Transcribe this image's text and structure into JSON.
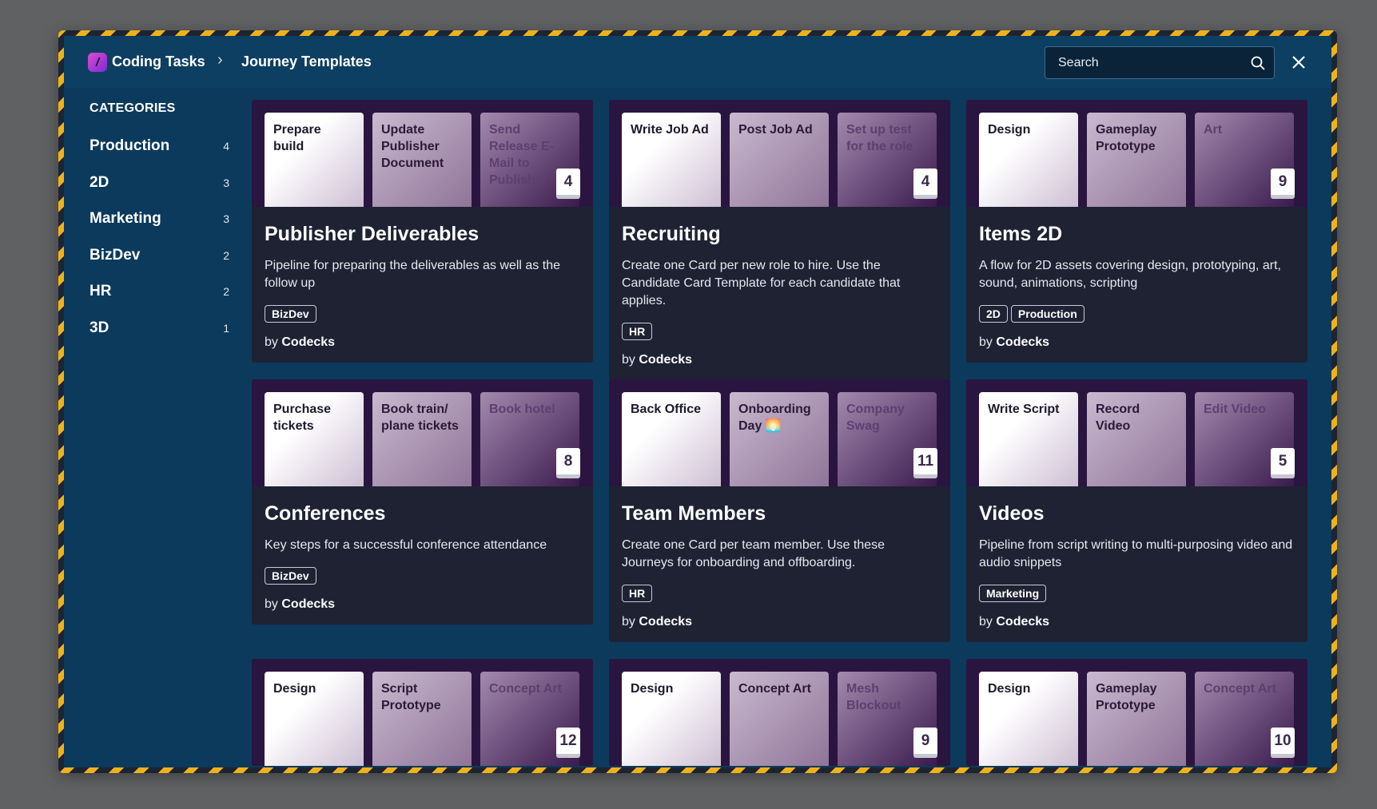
{
  "header": {
    "workspace": "Coding Tasks",
    "separator": "›",
    "current": "Journey Templates",
    "search_placeholder": "Search"
  },
  "sidebar": {
    "title": "CATEGORIES",
    "items": [
      {
        "label": "Production",
        "count": "4"
      },
      {
        "label": "2D",
        "count": "3"
      },
      {
        "label": "Marketing",
        "count": "3"
      },
      {
        "label": "BizDev",
        "count": "2"
      },
      {
        "label": "HR",
        "count": "2"
      },
      {
        "label": "3D",
        "count": "1"
      }
    ]
  },
  "cards": [
    {
      "minis": [
        "Prepare build",
        "Update Publisher Document",
        "Send Release E-Mail to Publisher"
      ],
      "count": "4",
      "title": "Publisher Deliverables",
      "desc": "Pipeline for preparing the deliverables as well as the follow up",
      "tags": [
        "BizDev"
      ],
      "by": "by",
      "author": "Codecks"
    },
    {
      "minis": [
        "Write Job Ad",
        "Post Job Ad",
        "Set up test for the role"
      ],
      "count": "4",
      "title": "Recruiting",
      "desc": "Create one Card per new role to hire. Use the Candidate Card Template for each candidate that applies.",
      "tags": [
        "HR"
      ],
      "by": "by",
      "author": "Codecks"
    },
    {
      "minis": [
        "Design",
        "Gameplay Prototype",
        "Art"
      ],
      "count": "9",
      "title": "Items 2D",
      "desc": "A flow for 2D assets covering design, prototyping, art, sound, animations, scripting",
      "tags": [
        "2D",
        "Production"
      ],
      "by": "by",
      "author": "Codecks"
    },
    {
      "minis": [
        "Purchase tickets",
        "Book train/ plane tickets",
        "Book hotel"
      ],
      "count": "8",
      "title": "Conferences",
      "desc": "Key steps for a successful conference attendance",
      "tags": [
        "BizDev"
      ],
      "by": "by",
      "author": "Codecks"
    },
    {
      "minis": [
        "Back Office",
        "Onboarding Day 🌅",
        "Company Swag"
      ],
      "count": "11",
      "title": "Team Members",
      "desc": "Create one Card per team member. Use these Journeys for onboarding and offboarding.",
      "tags": [
        "HR"
      ],
      "by": "by",
      "author": "Codecks"
    },
    {
      "minis": [
        "Write Script",
        "Record Video",
        "Edit Video"
      ],
      "count": "5",
      "title": "Videos",
      "desc": "Pipeline from script writing to multi-purposing video and audio snippets",
      "tags": [
        "Marketing"
      ],
      "by": "by",
      "author": "Codecks"
    },
    {
      "minis": [
        "Design",
        "Script Prototype",
        "Concept Art"
      ],
      "count": "12",
      "title": "",
      "desc": "",
      "tags": [],
      "by": "",
      "author": ""
    },
    {
      "minis": [
        "Design",
        "Concept Art",
        "Mesh Blockout"
      ],
      "count": "9",
      "title": "",
      "desc": "",
      "tags": [],
      "by": "",
      "author": ""
    },
    {
      "minis": [
        "Design",
        "Gameplay Prototype",
        "Concept Art"
      ],
      "count": "10",
      "title": "",
      "desc": "",
      "tags": [],
      "by": "",
      "author": ""
    }
  ],
  "colors": {
    "background": "#5f6163",
    "window": "#0b3a5c",
    "header": "#0d3f62",
    "card": "#1e2233",
    "card_top": "#2a1540",
    "stripe_yellow": "#f0b21a"
  }
}
